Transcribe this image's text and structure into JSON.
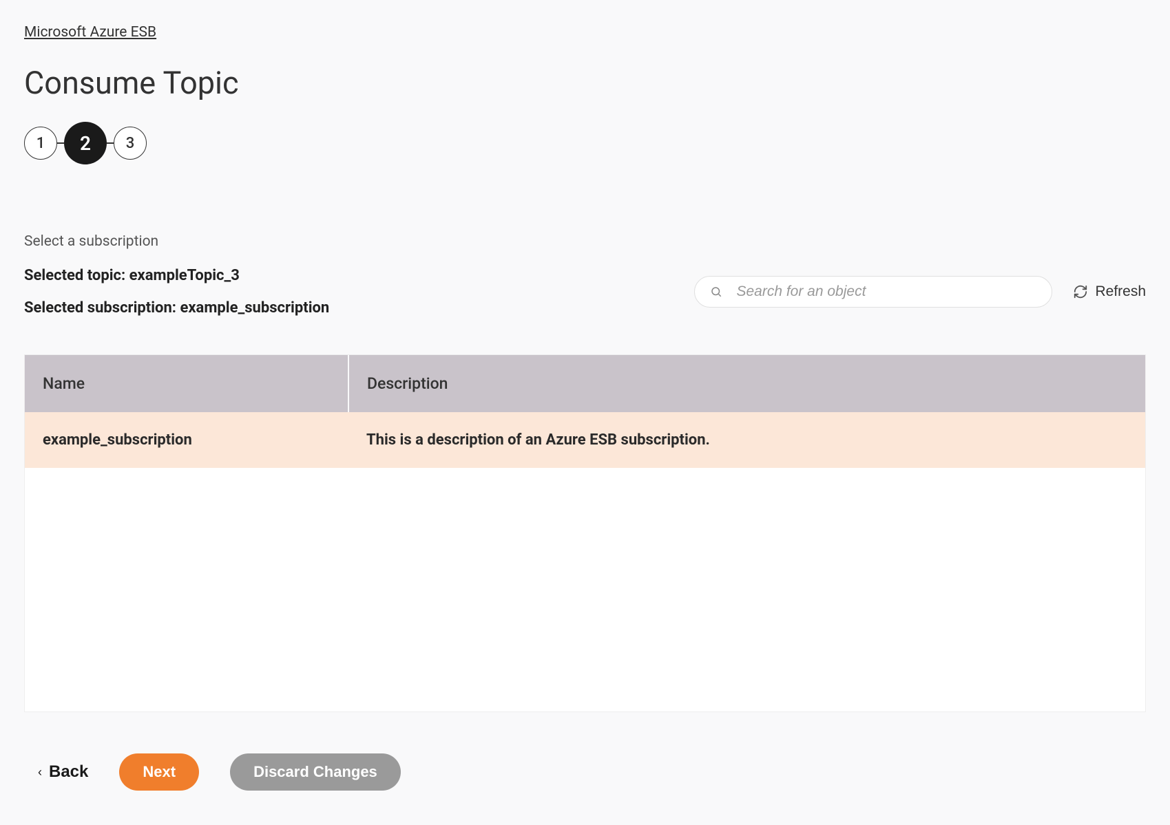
{
  "breadcrumb": {
    "label": "Microsoft Azure ESB"
  },
  "page": {
    "title": "Consume Topic"
  },
  "stepper": {
    "steps": [
      "1",
      "2",
      "3"
    ],
    "active_index": 1
  },
  "section": {
    "label": "Select a subscription",
    "selected_topic_label": "Selected topic: exampleTopic_3",
    "selected_subscription_label": "Selected subscription: example_subscription"
  },
  "search": {
    "placeholder": "Search for an object",
    "value": ""
  },
  "refresh": {
    "label": "Refresh"
  },
  "table": {
    "columns": {
      "name": "Name",
      "description": "Description"
    },
    "rows": [
      {
        "name": "example_subscription",
        "description": "This is a description of an Azure ESB subscription.",
        "selected": true
      }
    ]
  },
  "footer": {
    "back": "Back",
    "next": "Next",
    "discard": "Discard Changes"
  }
}
